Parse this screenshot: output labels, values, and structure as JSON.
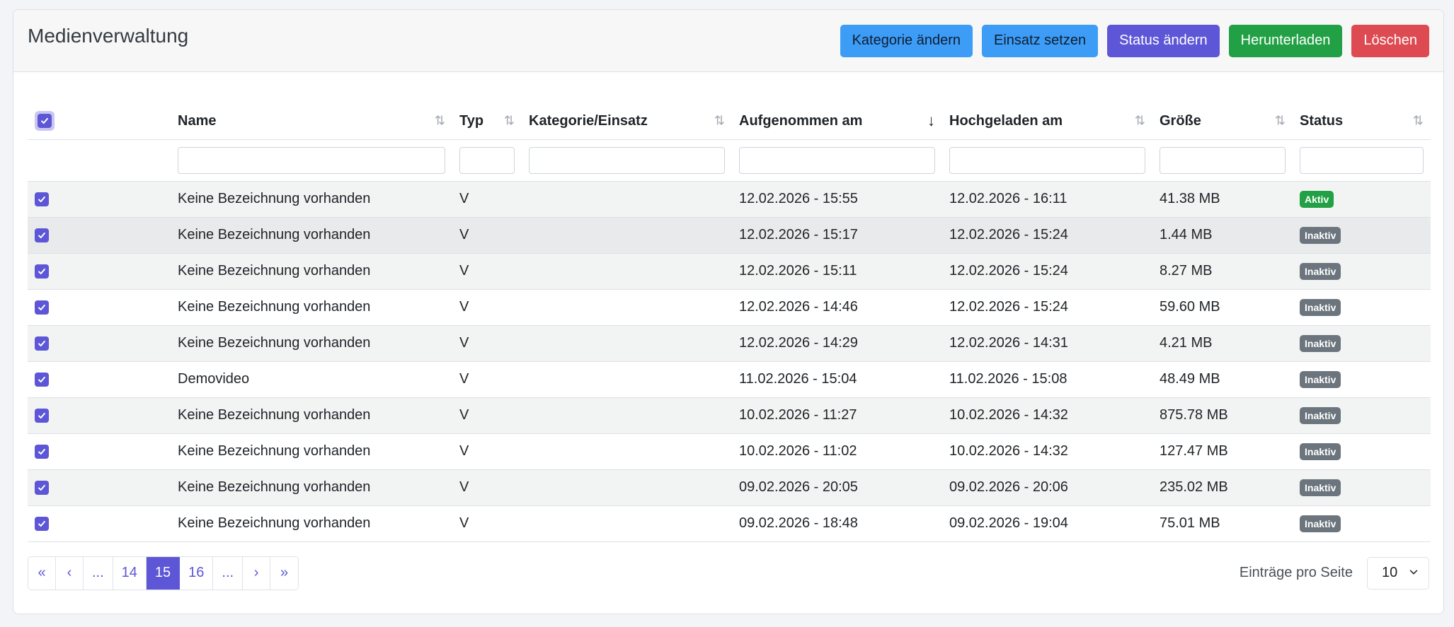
{
  "header": {
    "title": "Medienverwaltung",
    "actions": [
      {
        "label": "Kategorie ändern",
        "style": "blue"
      },
      {
        "label": "Einsatz setzen",
        "style": "blue"
      },
      {
        "label": "Status ändern",
        "style": "purple"
      },
      {
        "label": "Herunterladen",
        "style": "green"
      },
      {
        "label": "Löschen",
        "style": "red"
      }
    ]
  },
  "table": {
    "columns": [
      {
        "key": "select",
        "label": "",
        "sort": ""
      },
      {
        "key": "name",
        "label": "Name",
        "sort": "⇅"
      },
      {
        "key": "typ",
        "label": "Typ",
        "sort": "⇅"
      },
      {
        "key": "kategorie",
        "label": "Kategorie/Einsatz",
        "sort": "⇅"
      },
      {
        "key": "aufgenommen",
        "label": "Aufgenommen am",
        "sort": "↓"
      },
      {
        "key": "hochgeladen",
        "label": "Hochgeladen am",
        "sort": "⇅"
      },
      {
        "key": "groesse",
        "label": "Größe",
        "sort": "⇅"
      },
      {
        "key": "status",
        "label": "Status",
        "sort": "⇅"
      }
    ],
    "rows": [
      {
        "name": "Keine Bezeichnung vorhanden",
        "typ": "V",
        "kategorie": "",
        "aufgenommen": "12.02.2026 - 15:55",
        "hochgeladen": "12.02.2026 - 16:11",
        "groesse": "41.38 MB",
        "status": "Aktiv"
      },
      {
        "name": "Keine Bezeichnung vorhanden",
        "typ": "V",
        "kategorie": "",
        "aufgenommen": "12.02.2026 - 15:17",
        "hochgeladen": "12.02.2026 - 15:24",
        "groesse": "1.44 MB",
        "status": "Inaktiv"
      },
      {
        "name": "Keine Bezeichnung vorhanden",
        "typ": "V",
        "kategorie": "",
        "aufgenommen": "12.02.2026 - 15:11",
        "hochgeladen": "12.02.2026 - 15:24",
        "groesse": "8.27 MB",
        "status": "Inaktiv"
      },
      {
        "name": "Keine Bezeichnung vorhanden",
        "typ": "V",
        "kategorie": "",
        "aufgenommen": "12.02.2026 - 14:46",
        "hochgeladen": "12.02.2026 - 15:24",
        "groesse": "59.60 MB",
        "status": "Inaktiv"
      },
      {
        "name": "Keine Bezeichnung vorhanden",
        "typ": "V",
        "kategorie": "",
        "aufgenommen": "12.02.2026 - 14:29",
        "hochgeladen": "12.02.2026 - 14:31",
        "groesse": "4.21 MB",
        "status": "Inaktiv"
      },
      {
        "name": "Demovideo",
        "typ": "V",
        "kategorie": "",
        "aufgenommen": "11.02.2026 - 15:04",
        "hochgeladen": "11.02.2026 - 15:08",
        "groesse": "48.49 MB",
        "status": "Inaktiv"
      },
      {
        "name": "Keine Bezeichnung vorhanden",
        "typ": "V",
        "kategorie": "",
        "aufgenommen": "10.02.2026 - 11:27",
        "hochgeladen": "10.02.2026 - 14:32",
        "groesse": "875.78 MB",
        "status": "Inaktiv"
      },
      {
        "name": "Keine Bezeichnung vorhanden",
        "typ": "V",
        "kategorie": "",
        "aufgenommen": "10.02.2026 - 11:02",
        "hochgeladen": "10.02.2026 - 14:32",
        "groesse": "127.47 MB",
        "status": "Inaktiv"
      },
      {
        "name": "Keine Bezeichnung vorhanden",
        "typ": "V",
        "kategorie": "",
        "aufgenommen": "09.02.2026 - 20:05",
        "hochgeladen": "09.02.2026 - 20:06",
        "groesse": "235.02 MB",
        "status": "Inaktiv"
      },
      {
        "name": "Keine Bezeichnung vorhanden",
        "typ": "V",
        "kategorie": "",
        "aufgenommen": "09.02.2026 - 18:48",
        "hochgeladen": "09.02.2026 - 19:04",
        "groesse": "75.01 MB",
        "status": "Inaktiv"
      }
    ]
  },
  "pagination": {
    "items": [
      "«",
      "‹",
      "...",
      "14",
      "15",
      "16",
      "...",
      "›",
      "»"
    ],
    "active": "15"
  },
  "per_page": {
    "label": "Einträge pro Seite",
    "value": "10"
  },
  "colors": {
    "accent": "#5d56d6",
    "blue": "#3d9df6",
    "green": "#22a045",
    "red": "#de4a52",
    "inactive": "#6c757d"
  },
  "icons": {
    "checkbox": "check-icon",
    "select": "chevron-down-icon"
  }
}
